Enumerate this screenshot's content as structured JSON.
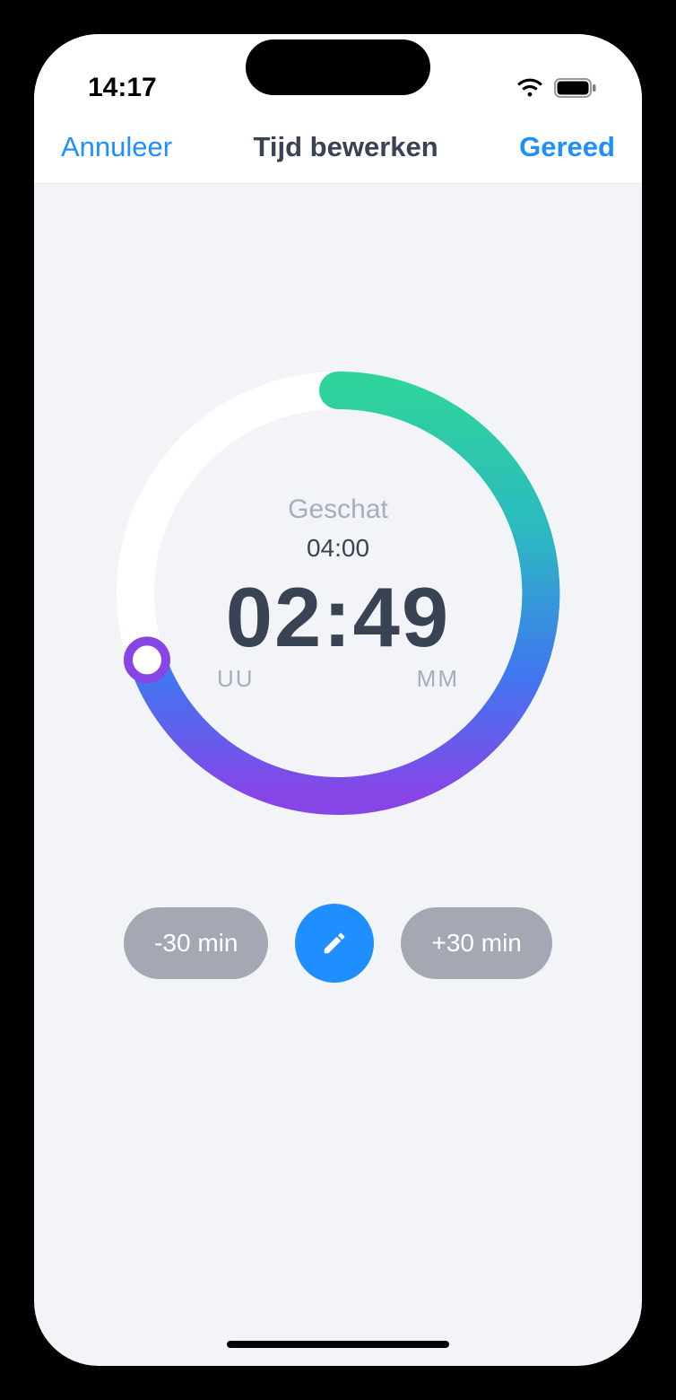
{
  "status": {
    "time": "14:17"
  },
  "nav": {
    "cancel": "Annuleer",
    "title": "Tijd bewerken",
    "done": "Gereed"
  },
  "dial": {
    "estimated_label": "Geschat",
    "estimated_value": "04:00",
    "time": "02:49",
    "hours_label": "UU",
    "minutes_label": "MM",
    "progress_fraction": 0.704
  },
  "buttons": {
    "minus": "-30 min",
    "plus": "+30 min"
  },
  "colors": {
    "accent": "#1f8fff",
    "grad_green": "#2fd39c",
    "grad_teal": "#2cb9c1",
    "grad_blue": "#3f77f0",
    "grad_purple": "#8745e6",
    "grey_pill": "#a3a8b2"
  }
}
